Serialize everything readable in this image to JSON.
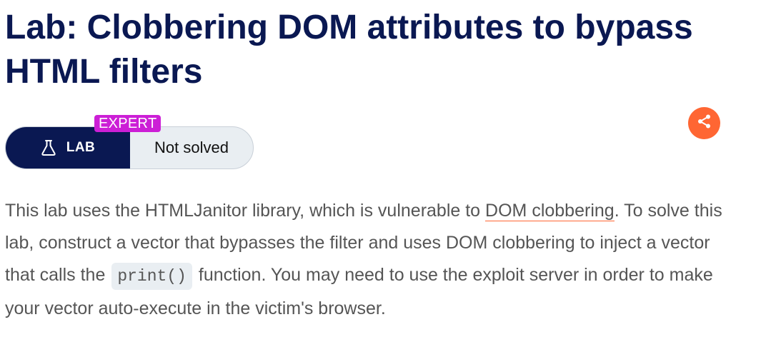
{
  "page": {
    "title": "Lab: Clobbering DOM attributes to bypass HTML filters"
  },
  "lab_badge": {
    "level": "EXPERT",
    "label": "LAB",
    "status": "Not solved",
    "icon": "flask-icon"
  },
  "share": {
    "icon": "share-icon"
  },
  "description": {
    "part1": "This lab uses the HTMLJanitor library, which is vulnerable to ",
    "link_text": "DOM clobbering",
    "part2": ". To solve this lab, construct a vector that bypasses the filter and uses DOM clobbering to inject a vector that calls the ",
    "code": "print()",
    "part3": " function. You may need to use the exploit server in order to make your vector auto-execute in the victim's browser."
  },
  "colors": {
    "title": "#0a1852",
    "lab_bg": "#0a1852",
    "expert_tag": "#cc1fd6",
    "status_bg": "#e9eef2",
    "share_bg": "#ff6633",
    "link_underline": "#ff6633",
    "body_text": "#555555"
  }
}
